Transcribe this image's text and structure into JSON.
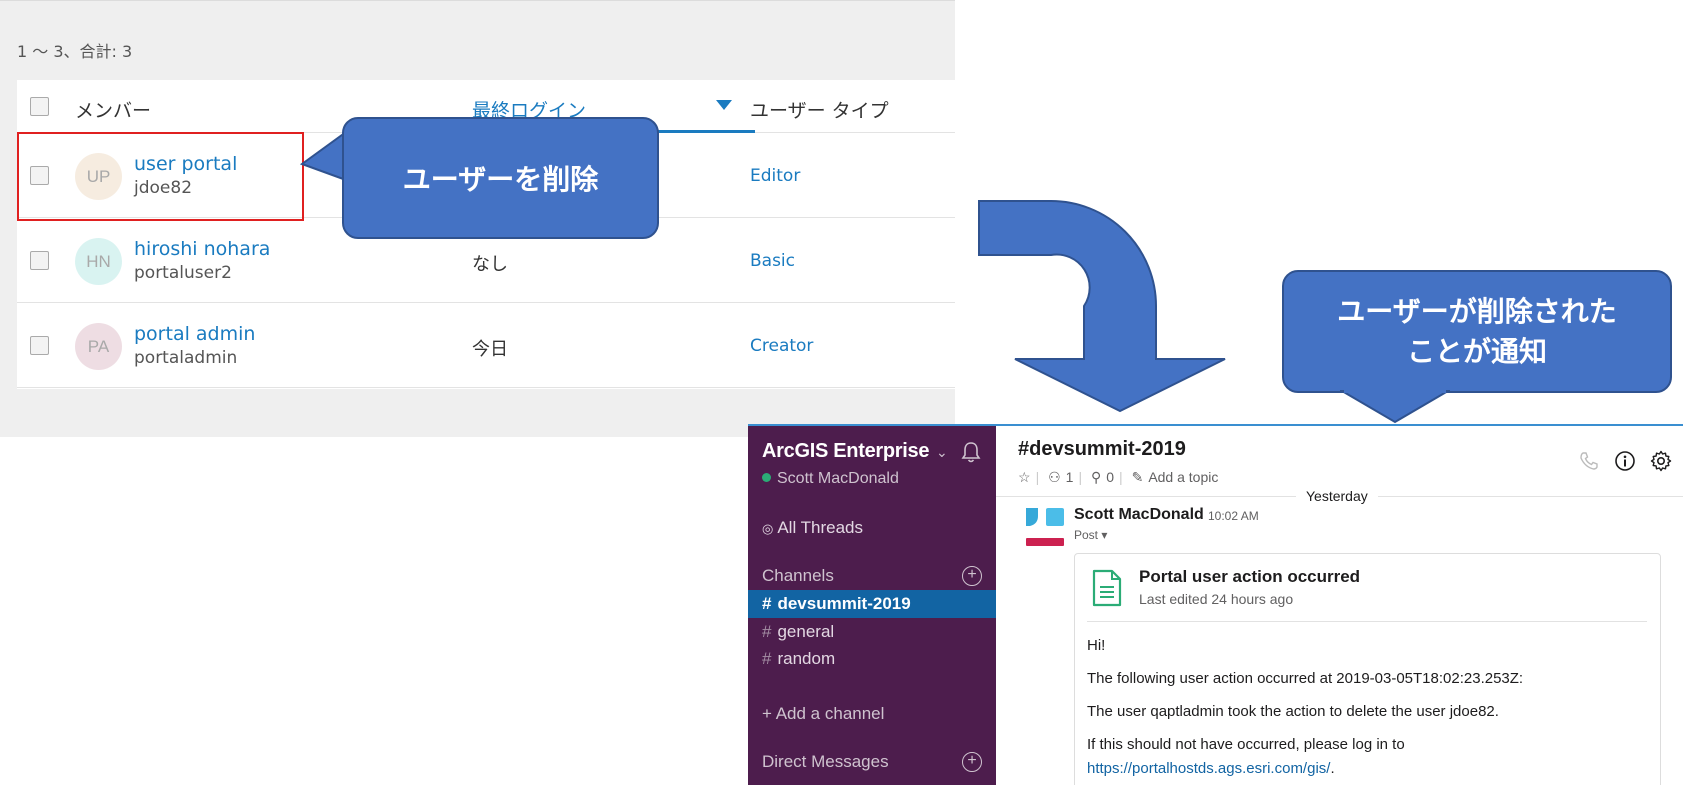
{
  "portal": {
    "result_count": "1 ～ 3、合計: 3",
    "columns": {
      "member": "メンバー",
      "last_login": "最終ログイン",
      "user_type": "ユーザー タイプ"
    },
    "members": [
      {
        "initials": "UP",
        "name": "user portal",
        "username": "jdoe82",
        "last_login": "",
        "user_type": "Editor",
        "avatar_color": "#f6ece0"
      },
      {
        "initials": "HN",
        "name": "hiroshi nohara",
        "username": "portaluser2",
        "last_login": "なし",
        "user_type": "Basic",
        "avatar_color": "#d9f3f1"
      },
      {
        "initials": "PA",
        "name": "portal admin",
        "username": "portaladmin",
        "last_login": "今日",
        "user_type": "Creator",
        "avatar_color": "#eedde3"
      }
    ]
  },
  "callouts": {
    "delete_user": "ユーザーを削除",
    "notify_line1": "ユーザーが削除された",
    "notify_line2": "ことが通知"
  },
  "slack": {
    "workspace": "ArcGIS Enterprise",
    "current_user": "Scott MacDonald",
    "all_threads": "All Threads",
    "channels_label": "Channels",
    "channels": [
      "devsummit-2019",
      "general",
      "random"
    ],
    "active_channel": "devsummit-2019",
    "add_channel": "+ Add a channel",
    "direct_messages_label": "Direct Messages",
    "channel_title": "#devsummit-2019",
    "member_count": "1",
    "pinned_count": "0",
    "add_topic": "Add a topic",
    "day_divider": "Yesterday",
    "message": {
      "author": "Scott MacDonald",
      "time": "10:02 AM",
      "type": "Post",
      "post_title": "Portal user action occurred",
      "post_edited": "Last edited 24 hours ago",
      "lines": [
        "Hi!",
        "The following user action occurred at 2019-03-05T18:02:23.253Z:",
        "The user qaptladmin took the action to delete the user jdoe82.",
        "If this should not have occurred, please log in to"
      ],
      "link": "https://portalhostds.ags.esri.com/gis/",
      "link_suffix": "."
    }
  },
  "colors": {
    "accent_blue": "#1a7bc0",
    "callout_fill": "#4472c4",
    "highlight_red": "#e02020",
    "slack_sidebar": "#4d1d4d",
    "slack_active": "#1264a3"
  }
}
